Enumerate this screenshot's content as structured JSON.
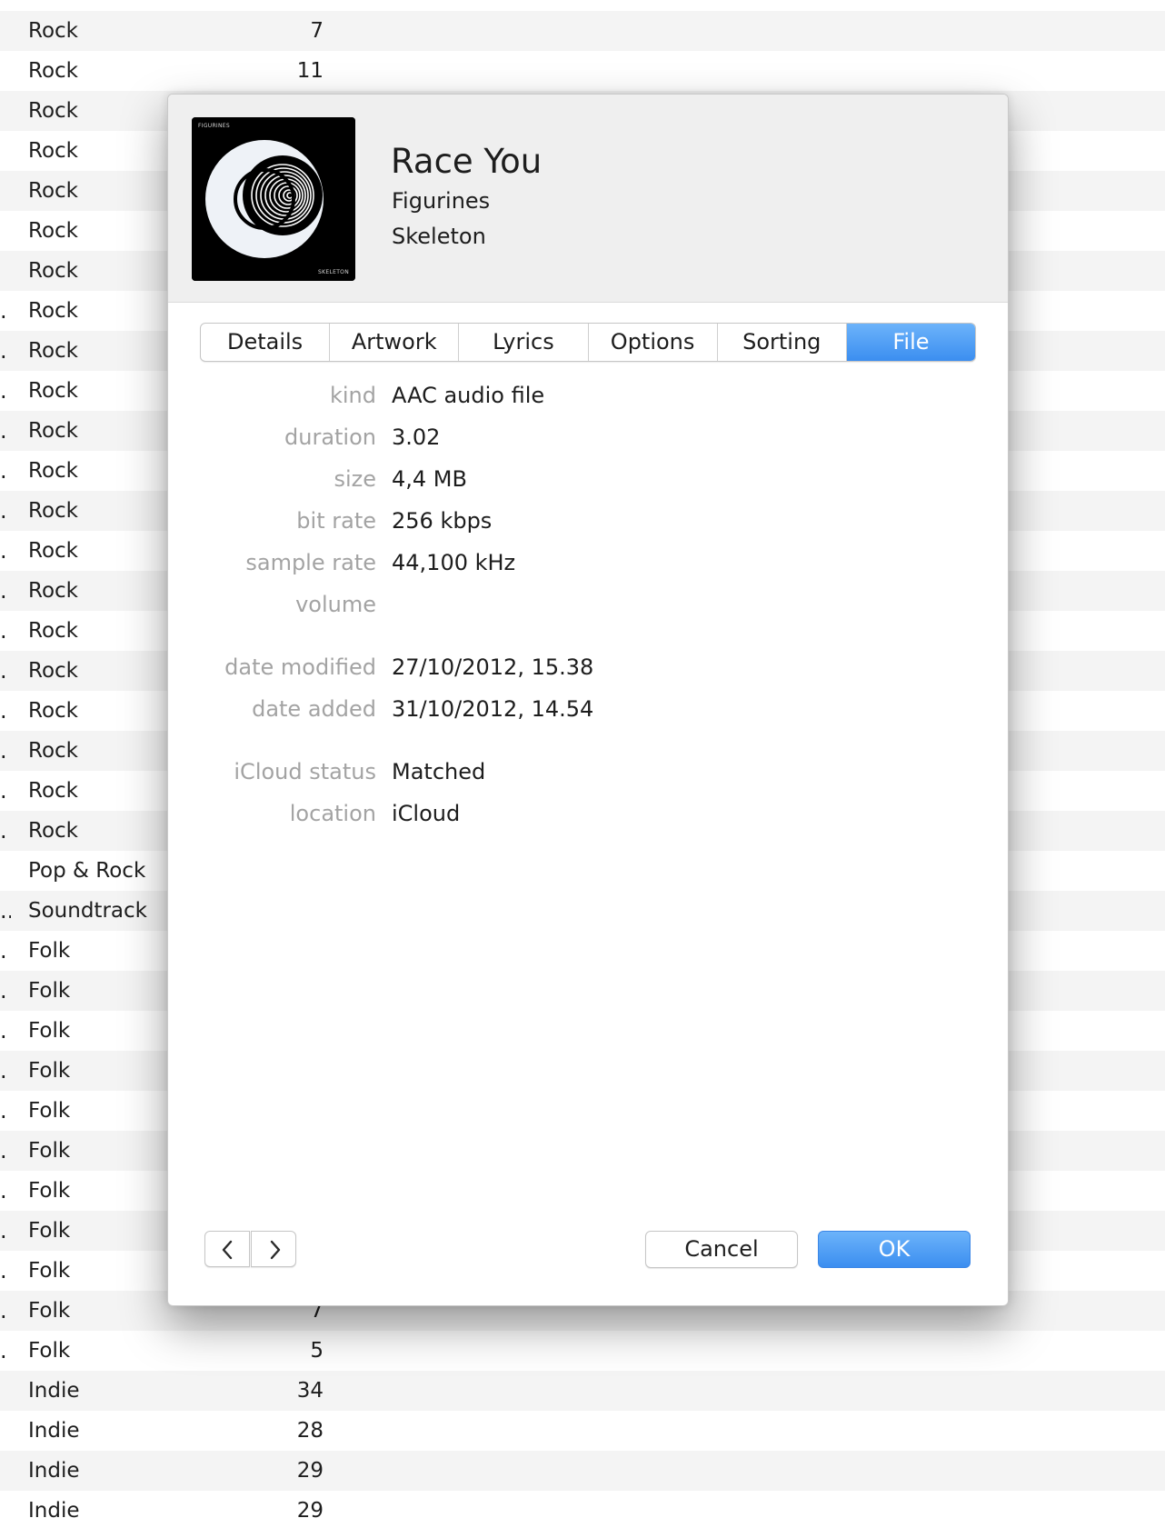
{
  "library": {
    "rows": [
      {
        "trunc": "",
        "genre": "Rock",
        "count": "7"
      },
      {
        "trunc": "",
        "genre": "Rock",
        "count": "11"
      },
      {
        "trunc": "",
        "genre": "Rock",
        "count": ""
      },
      {
        "trunc": "",
        "genre": "Rock",
        "count": ""
      },
      {
        "trunc": "",
        "genre": "Rock",
        "count": ""
      },
      {
        "trunc": "",
        "genre": "Rock",
        "count": ""
      },
      {
        "trunc": "",
        "genre": "Rock",
        "count": ""
      },
      {
        "trunc": ".",
        "genre": "Rock",
        "count": ""
      },
      {
        "trunc": ".",
        "genre": "Rock",
        "count": ""
      },
      {
        "trunc": ".",
        "genre": "Rock",
        "count": ""
      },
      {
        "trunc": ".",
        "genre": "Rock",
        "count": ""
      },
      {
        "trunc": ".",
        "genre": "Rock",
        "count": ""
      },
      {
        "trunc": ".",
        "genre": "Rock",
        "count": ""
      },
      {
        "trunc": ".",
        "genre": "Rock",
        "count": ""
      },
      {
        "trunc": ".",
        "genre": "Rock",
        "count": ""
      },
      {
        "trunc": ".",
        "genre": "Rock",
        "count": ""
      },
      {
        "trunc": ".",
        "genre": "Rock",
        "count": ""
      },
      {
        "trunc": ".",
        "genre": "Rock",
        "count": ""
      },
      {
        "trunc": ".",
        "genre": "Rock",
        "count": ""
      },
      {
        "trunc": ".",
        "genre": "Rock",
        "count": ""
      },
      {
        "trunc": ".",
        "genre": "Rock",
        "count": ""
      },
      {
        "trunc": "",
        "genre": "Pop & Rock",
        "count": ""
      },
      {
        "trunc": "..",
        "genre": "Soundtrack",
        "count": ""
      },
      {
        "trunc": ".",
        "genre": "Folk",
        "count": ""
      },
      {
        "trunc": ".",
        "genre": "Folk",
        "count": ""
      },
      {
        "trunc": ".",
        "genre": "Folk",
        "count": ""
      },
      {
        "trunc": ".",
        "genre": "Folk",
        "count": ""
      },
      {
        "trunc": ".",
        "genre": "Folk",
        "count": ""
      },
      {
        "trunc": ".",
        "genre": "Folk",
        "count": ""
      },
      {
        "trunc": ".",
        "genre": "Folk",
        "count": ""
      },
      {
        "trunc": ".",
        "genre": "Folk",
        "count": ""
      },
      {
        "trunc": ".",
        "genre": "Folk",
        "count": ""
      },
      {
        "trunc": ".",
        "genre": "Folk",
        "count": "7"
      },
      {
        "trunc": ".",
        "genre": "Folk",
        "count": "5"
      },
      {
        "trunc": "",
        "genre": "Indie",
        "count": "34"
      },
      {
        "trunc": "",
        "genre": "Indie",
        "count": "28"
      },
      {
        "trunc": "",
        "genre": "Indie",
        "count": "29"
      },
      {
        "trunc": "",
        "genre": "Indie",
        "count": "29"
      }
    ]
  },
  "dialog": {
    "artwork": {
      "top_text": "FIGURINES",
      "bottom_text": "SKELETON"
    },
    "title": "Race You",
    "artist": "Figurines",
    "album": "Skeleton",
    "tabs": [
      {
        "label": "Details",
        "active": false
      },
      {
        "label": "Artwork",
        "active": false
      },
      {
        "label": "Lyrics",
        "active": false
      },
      {
        "label": "Options",
        "active": false
      },
      {
        "label": "Sorting",
        "active": false
      },
      {
        "label": "File",
        "active": true
      }
    ],
    "file_info": [
      {
        "label": "kind",
        "value": "AAC audio file"
      },
      {
        "label": "duration",
        "value": "3.02"
      },
      {
        "label": "size",
        "value": "4,4 MB"
      },
      {
        "label": "bit rate",
        "value": "256 kbps"
      },
      {
        "label": "sample rate",
        "value": "44,100 kHz"
      },
      {
        "label": "volume",
        "value": ""
      },
      {
        "label": "date modified",
        "value": "27/10/2012, 15.38"
      },
      {
        "label": "date added",
        "value": "31/10/2012, 14.54"
      },
      {
        "label": "iCloud status",
        "value": "Matched"
      },
      {
        "label": "location",
        "value": "iCloud"
      }
    ],
    "buttons": {
      "prev_icon": "chevron-left-icon",
      "next_icon": "chevron-right-icon",
      "cancel": "Cancel",
      "ok": "OK"
    }
  },
  "colors": {
    "accent": "#3b8ef0",
    "row_stripe": "#f4f4f4",
    "label_gray": "#a3a3a3"
  }
}
